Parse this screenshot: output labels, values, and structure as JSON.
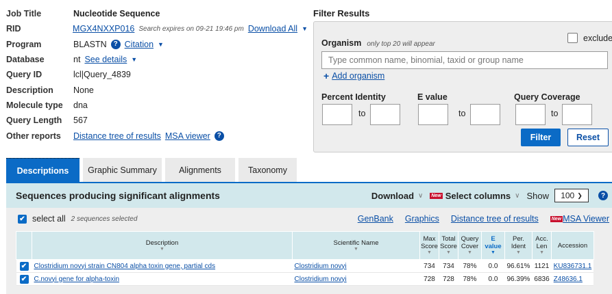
{
  "summary": {
    "job_title_label": "Job Title",
    "job_title": "Nucleotide Sequence",
    "rid_label": "RID",
    "rid": "MGX4NXXP016",
    "rid_note": "Search expires on 09-21 19:46 pm",
    "download_all": "Download All",
    "program_label": "Program",
    "program": "BLASTN",
    "citation": "Citation",
    "database_label": "Database",
    "database": "nt",
    "see_details": "See details",
    "query_id_label": "Query ID",
    "query_id": "lcl|Query_4839",
    "description_label": "Description",
    "description": "None",
    "molecule_type_label": "Molecule type",
    "molecule_type": "dna",
    "query_length_label": "Query Length",
    "query_length": "567",
    "other_reports_label": "Other reports",
    "distance_tree": "Distance tree of results",
    "msa_viewer": "MSA viewer"
  },
  "filter": {
    "title": "Filter Results",
    "organism_label": "Organism",
    "organism_note": "only top 20 will appear",
    "exclude": "exclude",
    "organism_placeholder": "Type common  name, binomial, taxid or group  name",
    "add_organism": "Add organism",
    "percent_identity": "Percent Identity",
    "e_value": "E value",
    "query_coverage": "Query Coverage",
    "to": "to",
    "filter_button": "Filter",
    "reset_button": "Reset"
  },
  "tabs": [
    "Descriptions",
    "Graphic Summary",
    "Alignments",
    "Taxonomy"
  ],
  "results": {
    "title": "Sequences producing significant alignments",
    "download": "Download",
    "new_badge": "New",
    "select_columns": "Select columns",
    "show": "Show",
    "show_value": "100",
    "select_all": "select all",
    "selected_note": "2 sequences selected",
    "links": [
      "GenBank",
      "Graphics",
      "Distance tree of results",
      "MSA Viewer"
    ]
  },
  "table": {
    "headers": {
      "description": "Description",
      "scientific_name": "Scientific Name",
      "max_score": [
        "Max",
        "Score"
      ],
      "total_score": [
        "Total",
        "Score"
      ],
      "query_cover": [
        "Query",
        "Cover"
      ],
      "e_value": [
        "E",
        "value"
      ],
      "per_ident": [
        "Per.",
        "Ident"
      ],
      "acc_len": [
        "Acc.",
        "Len"
      ],
      "accession": "Accession"
    },
    "rows": [
      {
        "description": "Clostridium novyi strain CN804 alpha toxin gene, partial cds",
        "scientific_name": "Clostridium novyi",
        "max_score": "734",
        "total_score": "734",
        "query_cover": "78%",
        "e_value": "0.0",
        "per_ident": "96.61%",
        "acc_len": "1121",
        "accession": "KU836731.1"
      },
      {
        "description": "C.novyi gene for alpha-toxin",
        "scientific_name": "Clostridium novyi",
        "max_score": "728",
        "total_score": "728",
        "query_cover": "78%",
        "e_value": "0.0",
        "per_ident": "96.39%",
        "acc_len": "6836",
        "accession": "Z48636.1"
      }
    ]
  },
  "icons": {
    "help": "?",
    "checkmark": "✔",
    "caret": "❯",
    "plus": "+"
  },
  "colors": {
    "primary": "#0b6bc6",
    "link": "#0a4fa6",
    "header_bg": "#d2e8ec",
    "new_badge": "#c8102e"
  }
}
